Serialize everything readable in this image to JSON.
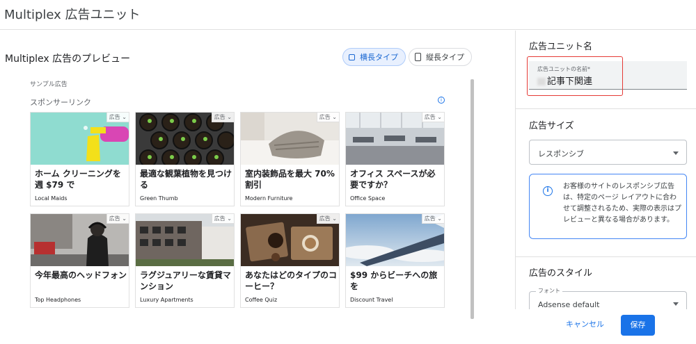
{
  "header": {
    "title": "Multiplex 広告ユニット"
  },
  "preview": {
    "title": "Multiplex 広告のプレビュー",
    "toggle_horizontal": "横長タイプ",
    "toggle_vertical": "縦長タイプ",
    "sample_label": "サンプル広告",
    "sponsored_label": "スポンサーリンク",
    "ad_badge": "広告",
    "cards": [
      {
        "headline": "ホーム クリーニングを週 $79 で",
        "source": "Local Maids"
      },
      {
        "headline": "最適な観葉植物を見つける",
        "source": "Green Thumb"
      },
      {
        "headline": "室内装飾品を最大 70% 割引",
        "source": "Modern Furniture"
      },
      {
        "headline": "オフィス スペースが必要ですか？",
        "source": "Office Space"
      },
      {
        "headline": "今年最高のヘッドフォン",
        "source": "Top Headphones"
      },
      {
        "headline": "ラグジュアリーな賃貸マンション",
        "source": "Luxury Apartments"
      },
      {
        "headline": "あなたはどのタイプのコーヒー？",
        "source": "Coffee Quiz"
      },
      {
        "headline": "$99 からビーチへの旅を",
        "source": "Discount Travel"
      }
    ]
  },
  "settings": {
    "unit_name_title": "広告ユニット名",
    "unit_name_label": "広告ユニットの名前*",
    "unit_name_value": "記事下関連",
    "size_title": "広告サイズ",
    "size_value": "レスポンシブ",
    "info_text": "お客様のサイトのレスポンシブ広告は、特定のページ レイアウトに合わせて調整されるため、実際の表示はプレビューと異なる場合があります。",
    "style_title": "広告のスタイル",
    "font_label": "フォント",
    "font_value": "Adsense default"
  },
  "actions": {
    "cancel": "キャンセル",
    "save": "保存"
  }
}
